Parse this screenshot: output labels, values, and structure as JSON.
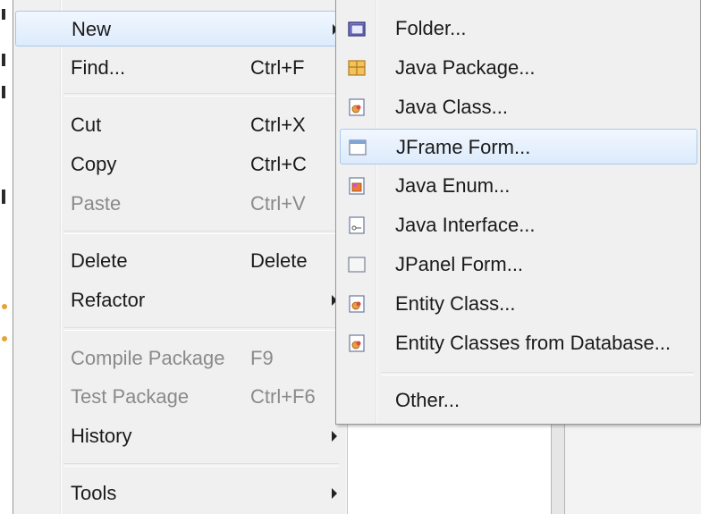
{
  "context_menu": {
    "items": [
      {
        "label": "New",
        "shortcut": "",
        "has_submenu": true,
        "disabled": false
      },
      {
        "label": "Find...",
        "shortcut": "Ctrl+F",
        "has_submenu": false,
        "disabled": false
      },
      {
        "label": "Cut",
        "shortcut": "Ctrl+X",
        "has_submenu": false,
        "disabled": false
      },
      {
        "label": "Copy",
        "shortcut": "Ctrl+C",
        "has_submenu": false,
        "disabled": false
      },
      {
        "label": "Paste",
        "shortcut": "Ctrl+V",
        "has_submenu": false,
        "disabled": true
      },
      {
        "label": "Delete",
        "shortcut": "Delete",
        "has_submenu": false,
        "disabled": false
      },
      {
        "label": "Refactor",
        "shortcut": "",
        "has_submenu": true,
        "disabled": false
      },
      {
        "label": "Compile Package",
        "shortcut": "F9",
        "has_submenu": false,
        "disabled": true
      },
      {
        "label": "Test Package",
        "shortcut": "Ctrl+F6",
        "has_submenu": false,
        "disabled": true
      },
      {
        "label": "History",
        "shortcut": "",
        "has_submenu": true,
        "disabled": false
      },
      {
        "label": "Tools",
        "shortcut": "",
        "has_submenu": true,
        "disabled": false
      }
    ]
  },
  "submenu_new": {
    "items": [
      {
        "label": "Folder...",
        "icon": "folder-icon"
      },
      {
        "label": "Java Package...",
        "icon": "package-icon"
      },
      {
        "label": "Java Class...",
        "icon": "java-class-icon"
      },
      {
        "label": "JFrame Form...",
        "icon": "jframe-form-icon"
      },
      {
        "label": "Java Enum...",
        "icon": "java-enum-icon"
      },
      {
        "label": "Java Interface...",
        "icon": "java-interface-icon"
      },
      {
        "label": "JPanel Form...",
        "icon": "jpanel-form-icon"
      },
      {
        "label": "Entity Class...",
        "icon": "entity-class-icon"
      },
      {
        "label": "Entity Classes from Database...",
        "icon": "entity-database-icon"
      },
      {
        "label": "Other...",
        "icon": ""
      }
    ]
  },
  "colors": {
    "menu_bg": "#f0f0f0",
    "highlight_border": "#a8c9ee",
    "disabled_text": "#8a8a8a"
  }
}
